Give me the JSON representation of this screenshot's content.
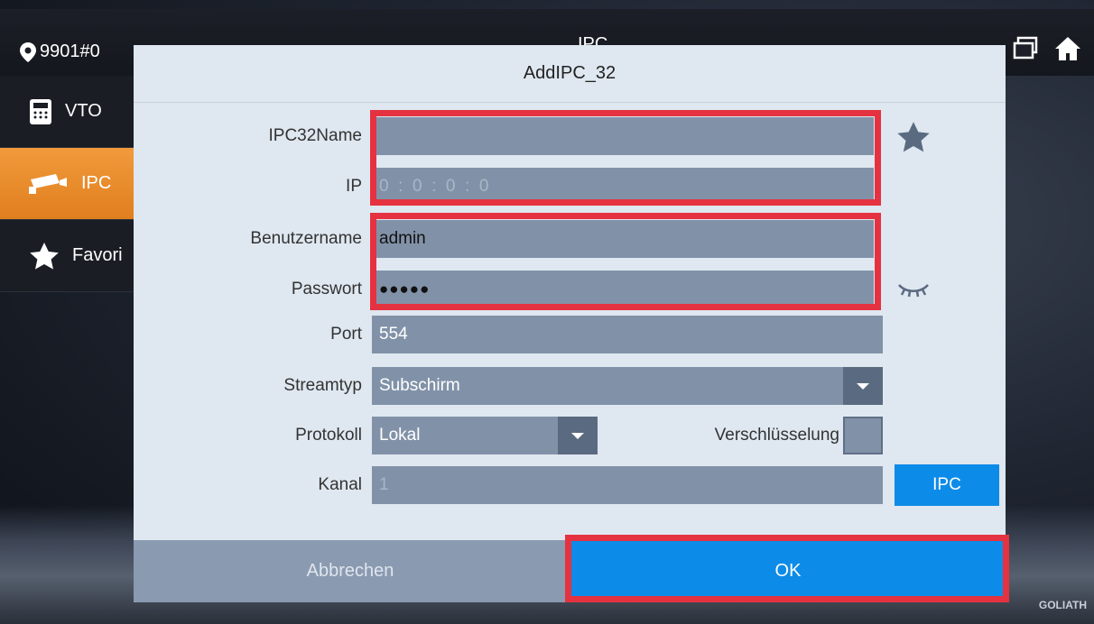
{
  "top": {
    "location": "9901#0",
    "title": "IPC"
  },
  "sidebar": {
    "items": [
      {
        "label": "VTO",
        "icon": "intercom-icon"
      },
      {
        "label": "IPC",
        "icon": "camera-icon",
        "active": true
      },
      {
        "label": "Favori",
        "icon": "star-icon"
      }
    ]
  },
  "dialog": {
    "title": "AddIPC_32",
    "fields": {
      "name": {
        "label": "IPC32Name",
        "value": ""
      },
      "ip": {
        "label": "IP",
        "placeholder": "0  :  0  :  0  :  0"
      },
      "username": {
        "label": "Benutzername",
        "value": "admin"
      },
      "password": {
        "label": "Passwort",
        "value": "●●●●●"
      },
      "port": {
        "label": "Port",
        "value": "554"
      },
      "streamtype": {
        "label": "Streamtyp",
        "value": "Subschirm"
      },
      "protocol": {
        "label": "Protokoll",
        "value": "Lokal"
      },
      "encryption": {
        "label": "Verschlüsselung"
      },
      "channel": {
        "label": "Kanal",
        "value": "1"
      }
    },
    "ipc_button": "IPC",
    "cancel_button": "Abbrechen",
    "ok_button": "OK"
  },
  "brand": "GOLIATH",
  "colors": {
    "accent_blue": "#0d8be8",
    "active_orange": "#e98a2a",
    "highlight_red": "#e53240",
    "field_gray": "#8192a8"
  }
}
